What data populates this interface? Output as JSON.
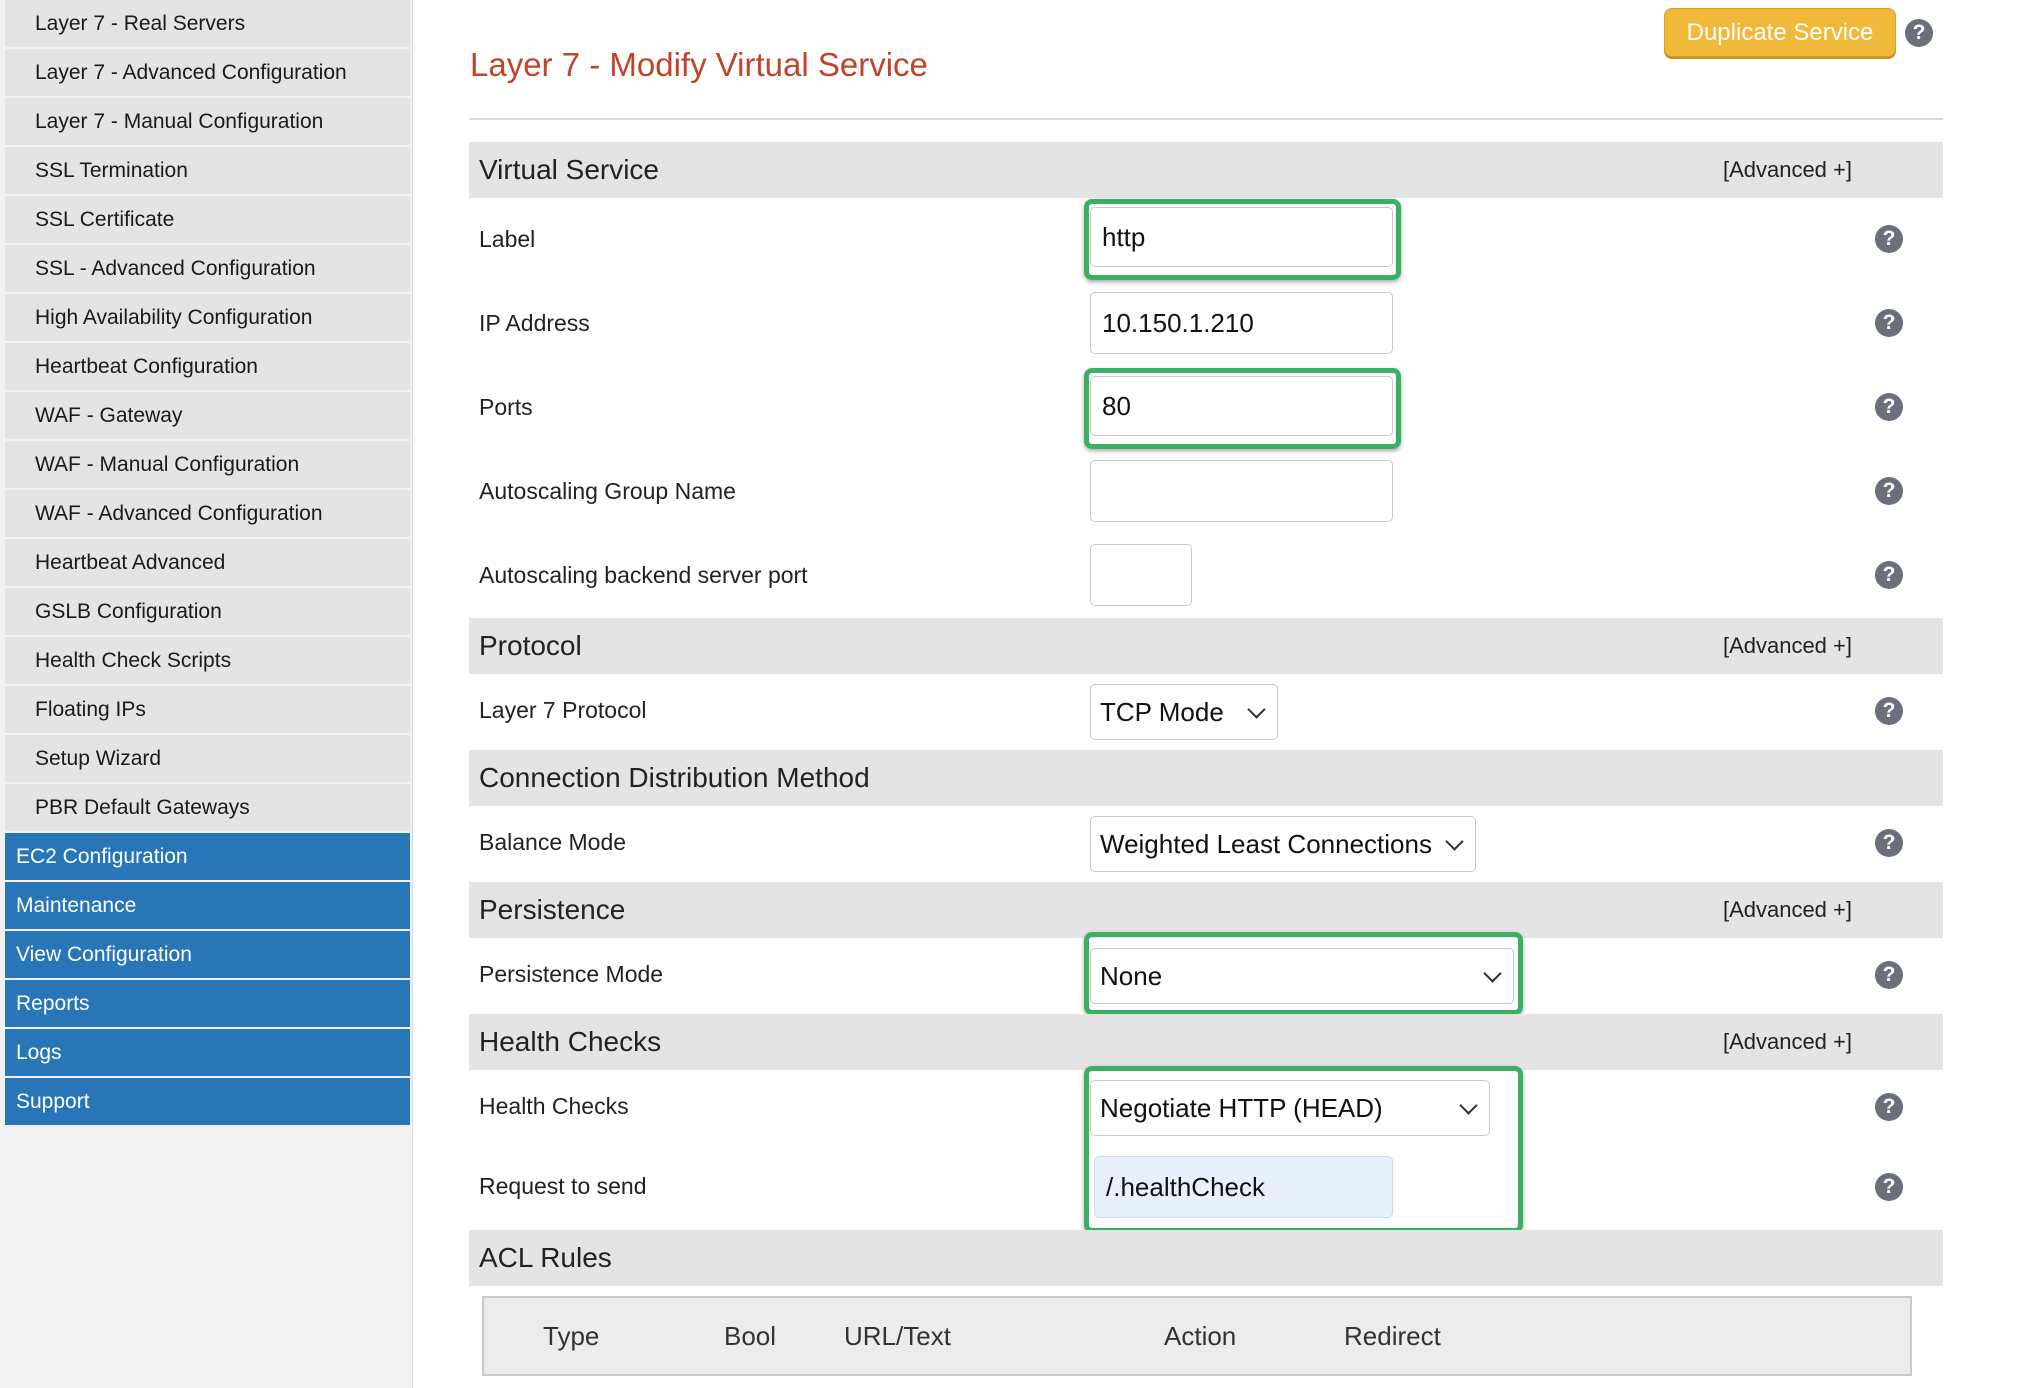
{
  "sidebar": {
    "items": [
      {
        "label": "Layer 7 - Real Servers"
      },
      {
        "label": "Layer 7 - Advanced Configuration"
      },
      {
        "label": "Layer 7 - Manual Configuration"
      },
      {
        "label": "SSL Termination"
      },
      {
        "label": "SSL Certificate"
      },
      {
        "label": "SSL - Advanced Configuration"
      },
      {
        "label": "High Availability Configuration"
      },
      {
        "label": "Heartbeat Configuration"
      },
      {
        "label": "WAF - Gateway"
      },
      {
        "label": "WAF - Manual Configuration"
      },
      {
        "label": "WAF - Advanced Configuration"
      },
      {
        "label": "Heartbeat Advanced"
      },
      {
        "label": "GSLB Configuration"
      },
      {
        "label": "Health Check Scripts"
      },
      {
        "label": "Floating IPs"
      },
      {
        "label": "Setup Wizard"
      },
      {
        "label": "PBR Default Gateways"
      }
    ],
    "top_items": [
      {
        "label": "EC2 Configuration"
      },
      {
        "label": "Maintenance"
      },
      {
        "label": "View Configuration"
      },
      {
        "label": "Reports"
      },
      {
        "label": "Logs"
      },
      {
        "label": "Support"
      }
    ]
  },
  "header": {
    "title": "Layer 7 - Modify Virtual Service",
    "duplicate_label": "Duplicate Service",
    "help_glyph": "?"
  },
  "sections": {
    "virtual_service": {
      "title": "Virtual Service",
      "advanced": "[Advanced +]"
    },
    "protocol": {
      "title": "Protocol",
      "advanced": "[Advanced +]"
    },
    "distribution": {
      "title": "Connection Distribution Method"
    },
    "persistence": {
      "title": "Persistence",
      "advanced": "[Advanced +]"
    },
    "health": {
      "title": "Health Checks",
      "advanced": "[Advanced +]"
    },
    "acl": {
      "title": "ACL Rules"
    }
  },
  "fields": {
    "label": {
      "label": "Label",
      "value": "http"
    },
    "ip": {
      "label": "IP Address",
      "value": "10.150.1.210"
    },
    "ports": {
      "label": "Ports",
      "value": "80"
    },
    "asg_name": {
      "label": "Autoscaling Group Name",
      "value": ""
    },
    "asg_port": {
      "label": "Autoscaling backend server port",
      "value": ""
    },
    "l7_protocol": {
      "label": "Layer 7 Protocol",
      "value": "TCP Mode"
    },
    "balance_mode": {
      "label": "Balance Mode",
      "value": "Weighted Least Connections"
    },
    "persistence_mode": {
      "label": "Persistence Mode",
      "value": "None"
    },
    "health_checks": {
      "label": "Health Checks",
      "value": "Negotiate HTTP (HEAD)"
    },
    "request": {
      "label": "Request to send",
      "value": "/.healthCheck"
    }
  },
  "acl_table": {
    "headers": [
      "Type",
      "Bool",
      "URL/Text",
      "Action",
      "Redirect"
    ]
  },
  "colors": {
    "title": "#c0432a",
    "nav_blue": "#2876b8",
    "highlight_green": "#3cb062",
    "button_yellow": "#f0b93a"
  }
}
